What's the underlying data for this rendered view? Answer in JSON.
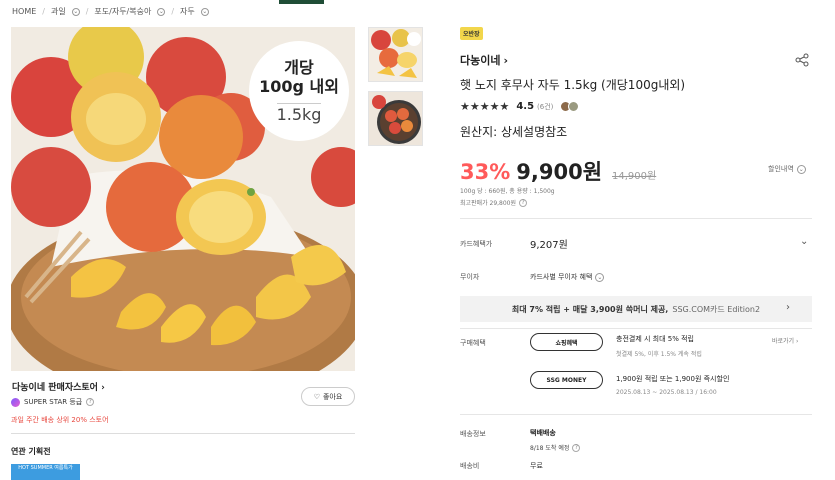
{
  "breadcrumb": [
    "HOME",
    "과일",
    "포도/자두/복숭아",
    "자두"
  ],
  "image_badge": {
    "line1": "개당",
    "line2": "100g 내외",
    "line3": "1.5kg"
  },
  "store": {
    "name": "다농이네 판매자스토어",
    "grade": "SUPER STAR 등급",
    "rank_text": "과일 주간 배송 상위 20% 스토어",
    "like_label": "좋아요"
  },
  "related": {
    "heading": "연관 기획전",
    "thumb_text": "HOT SUMMER 여름특가"
  },
  "product": {
    "tag": "오반장",
    "seller": "다농이네",
    "title": "햇 노지 후무사 자두 1.5kg (개당100g내외)",
    "stars": "★★★★★",
    "rating": "4.5",
    "review_count": "(6건)",
    "origin": "원산지: 상세설명참조",
    "discount": "33%",
    "price": "9,900원",
    "original_price": "14,900원",
    "discount_detail": "할인내역",
    "unit_price": "100g 당 : 660원, 총 용량 : 1,500g",
    "lowest_price": "최고판매가 29,800원"
  },
  "card": {
    "label": "카드혜택가",
    "value": "9,207원"
  },
  "installment": {
    "label": "무이자",
    "value": "카드사별 무이자 혜택"
  },
  "promo": {
    "text_bold": "최대 7% 적립 + 매달 3,900원 쓱머니 제공,",
    "text_grey": "SSG.COM카드 Edition2"
  },
  "benefits": {
    "label": "구매혜택",
    "view_more": "바로가기",
    "items": [
      {
        "pill": "쇼핑혜택",
        "main": "충전결제 시 최대 5% 적립",
        "sub": "첫결제 5%, 이후 1.5% 계속 적립"
      },
      {
        "pill": "SSG MONEY",
        "main": "1,900원 적립 또는 1,900원 즉시할인",
        "sub": "2025.08.13 ~ 2025.08.13 / 16:00"
      }
    ]
  },
  "shipping": {
    "label": "배송정보",
    "method": "택배배송",
    "eta": "8/18 도착 예정"
  },
  "fee": {
    "label": "배송비",
    "value": "무료"
  },
  "colors": {
    "accent_red": "#ff5a5a",
    "tag_yellow": "#f2d64b",
    "topbar_green": "#1f4d36"
  }
}
